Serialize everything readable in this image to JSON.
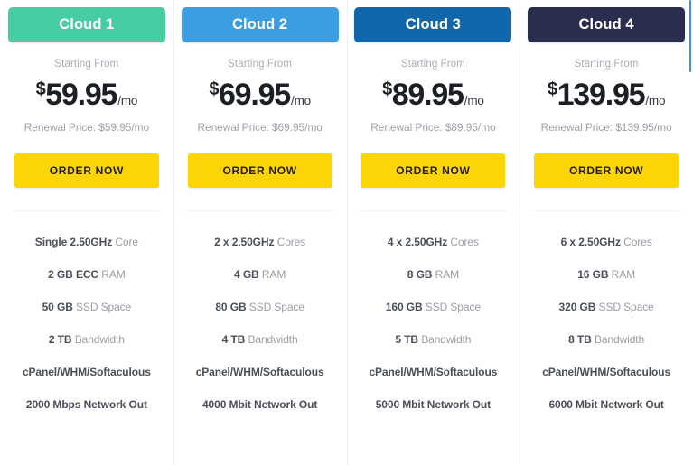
{
  "theme": {
    "page_background": "#ffffff",
    "divider_color": "#f0f1f3",
    "cta_color": "#fed504",
    "cta_text_color": "#231f0c",
    "muted_text_color": "#9a9da4",
    "strong_text_color": "#4a4f58",
    "price_text_color": "#1c2025",
    "scrollbar_color": "#4a90d9"
  },
  "labels": {
    "starting_from": "Starting From",
    "order_now": "ORDER NOW",
    "currency_symbol": "$",
    "period_suffix": "/mo"
  },
  "plans": [
    {
      "name": "Cloud 1",
      "header_color": "#46cda4",
      "starting_from": "Starting From",
      "currency": "$",
      "price": "59.95",
      "period": "/mo",
      "renewal": "Renewal Price: $59.95/mo",
      "cta": "ORDER NOW",
      "features": [
        {
          "strong": "Single 2.50GHz",
          "muted": " Core",
          "all_strong": false
        },
        {
          "strong": "2 GB ECC",
          "muted": " RAM",
          "all_strong": false
        },
        {
          "strong": "50 GB",
          "muted": " SSD Space",
          "all_strong": false
        },
        {
          "strong": "2 TB",
          "muted": " Bandwidth",
          "all_strong": false
        },
        {
          "strong": "cPanel/WHM/Softaculous",
          "muted": "",
          "all_strong": true
        },
        {
          "strong": "2000 Mbps Network Out",
          "muted": "",
          "all_strong": true
        }
      ]
    },
    {
      "name": "Cloud 2",
      "header_color": "#3a9ee0",
      "starting_from": "Starting From",
      "currency": "$",
      "price": "69.95",
      "period": "/mo",
      "renewal": "Renewal Price: $69.95/mo",
      "cta": "ORDER NOW",
      "features": [
        {
          "strong": "2 x 2.50GHz",
          "muted": " Cores",
          "all_strong": false
        },
        {
          "strong": "4 GB",
          "muted": " RAM",
          "all_strong": false
        },
        {
          "strong": "80 GB",
          "muted": " SSD Space",
          "all_strong": false
        },
        {
          "strong": "4 TB",
          "muted": " Bandwidth",
          "all_strong": false
        },
        {
          "strong": "cPanel/WHM/Softaculous",
          "muted": "",
          "all_strong": true
        },
        {
          "strong": "4000 Mbit Network Out",
          "muted": "",
          "all_strong": true
        }
      ]
    },
    {
      "name": "Cloud 3",
      "header_color": "#1267ab",
      "starting_from": "Starting From",
      "currency": "$",
      "price": "89.95",
      "period": "/mo",
      "renewal": "Renewal Price: $89.95/mo",
      "cta": "ORDER NOW",
      "features": [
        {
          "strong": "4 x 2.50GHz",
          "muted": " Cores",
          "all_strong": false
        },
        {
          "strong": "8 GB",
          "muted": " RAM",
          "all_strong": false
        },
        {
          "strong": "160 GB",
          "muted": " SSD Space",
          "all_strong": false
        },
        {
          "strong": "5 TB",
          "muted": " Bandwidth",
          "all_strong": false
        },
        {
          "strong": "cPanel/WHM/Softaculous",
          "muted": "",
          "all_strong": true
        },
        {
          "strong": "5000 Mbit Network Out",
          "muted": "",
          "all_strong": true
        }
      ]
    },
    {
      "name": "Cloud 4",
      "header_color": "#2b2d4e",
      "starting_from": "Starting From",
      "currency": "$",
      "price": "139.95",
      "period": "/mo",
      "renewal": "Renewal Price: $139.95/mo",
      "cta": "ORDER NOW",
      "features": [
        {
          "strong": "6 x 2.50GHz",
          "muted": " Cores",
          "all_strong": false
        },
        {
          "strong": "16 GB",
          "muted": " RAM",
          "all_strong": false
        },
        {
          "strong": "320 GB",
          "muted": " SSD Space",
          "all_strong": false
        },
        {
          "strong": "8 TB",
          "muted": " Bandwidth",
          "all_strong": false
        },
        {
          "strong": "cPanel/WHM/Softaculous",
          "muted": "",
          "all_strong": true
        },
        {
          "strong": "6000 Mbit Network Out",
          "muted": "",
          "all_strong": true
        }
      ]
    }
  ]
}
